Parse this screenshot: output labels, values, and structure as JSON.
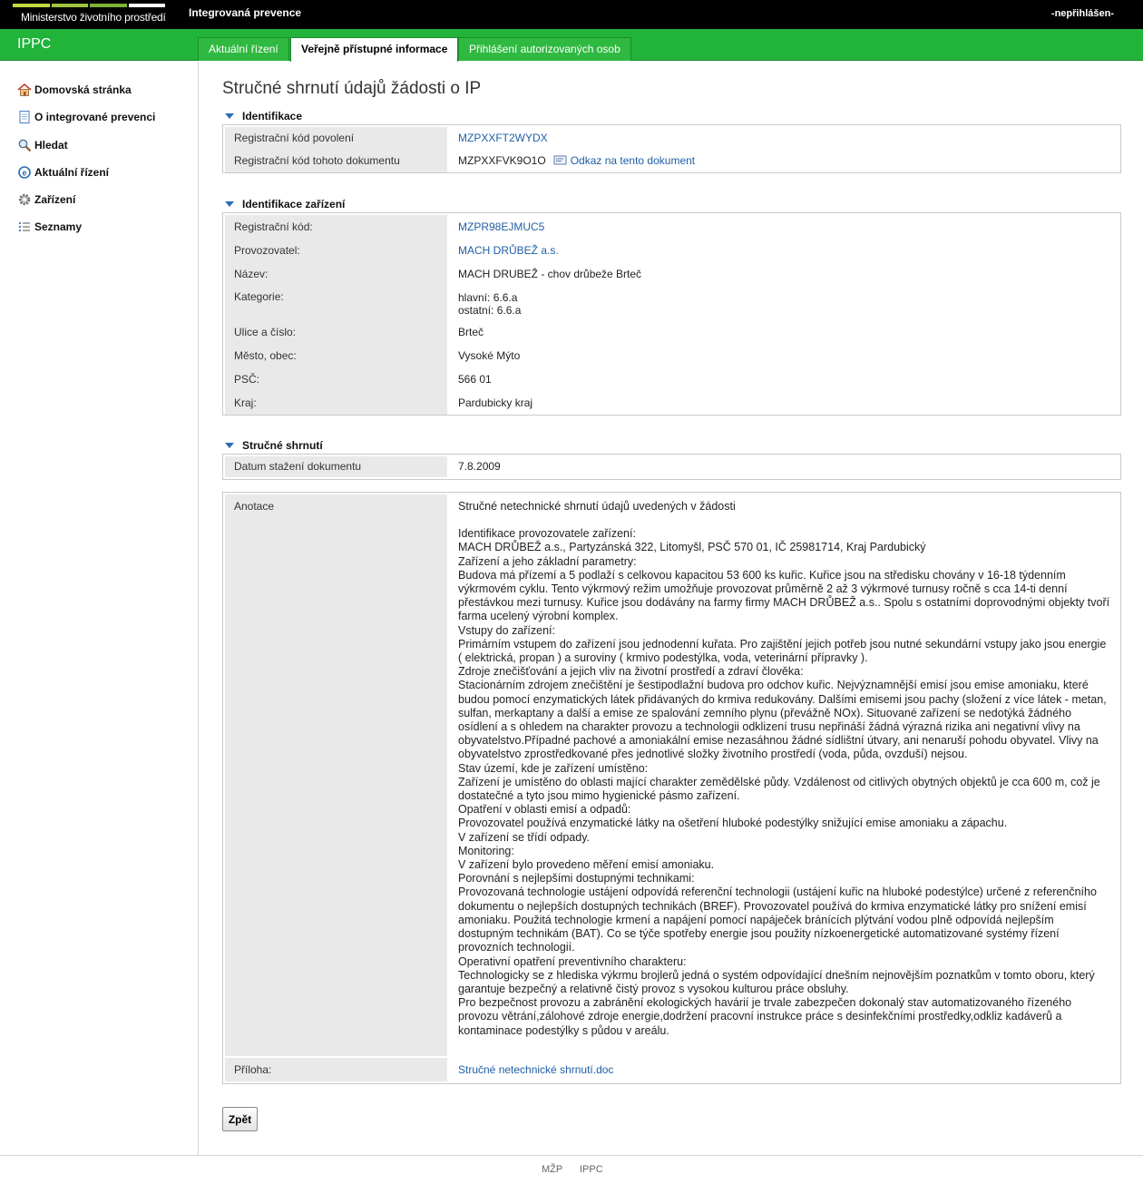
{
  "header": {
    "ministry_name": "Ministerstvo životního prostředí",
    "app_title": "Integrovaná prevence",
    "login_status": "-nepřihlášen-",
    "stripe_colors": [
      "#c3d93f",
      "#9fc43c",
      "#7fb239",
      "#ffffff"
    ]
  },
  "nav": {
    "app_code": "IPPC",
    "tabs": [
      {
        "label": "Aktuální řízení",
        "active": false
      },
      {
        "label": "Veřejně přístupné informace",
        "active": true
      },
      {
        "label": "Přihlášení autorizovaných osob",
        "active": false
      }
    ]
  },
  "sidebar": {
    "items": [
      {
        "label": "Domovská stránka",
        "icon": "home-icon"
      },
      {
        "label": "O integrované prevenci",
        "icon": "document-icon"
      },
      {
        "label": "Hledat",
        "icon": "magnifier-icon"
      },
      {
        "label": "Aktuální řízení",
        "icon": "e-icon"
      },
      {
        "label": "Zařízení",
        "icon": "gear-icon"
      },
      {
        "label": "Seznamy",
        "icon": "list-icon"
      }
    ]
  },
  "page": {
    "title": "Stručné shrnutí údajů žádosti o IP",
    "sections": {
      "identification": {
        "heading": "Identifikace",
        "rows": [
          {
            "label": "Registrační kód povolení",
            "value": "MZPXXFT2WYDX"
          },
          {
            "label": "Registrační kód tohoto dokumentu",
            "value": "MZPXXFVK9O1O",
            "link": "Odkaz na tento dokument"
          }
        ]
      },
      "facility": {
        "heading": "Identifikace zařízení",
        "rows": [
          {
            "label": "Registrační kód:",
            "value": "MZPR98EJMUC5"
          },
          {
            "label": "Provozovatel:",
            "value": "MACH DRŮBEŽ a.s."
          },
          {
            "label": "Název:",
            "value": "MACH DRUBEŽ - chov drůbeže Brteč"
          },
          {
            "label": "Kategorie:",
            "value": "hlavní: 6.6.a",
            "value2": "ostatní: 6.6.a"
          },
          {
            "label": "Ulice a číslo:",
            "value": "Brteč"
          },
          {
            "label": "Město, obec:",
            "value": "Vysoké Mýto"
          },
          {
            "label": "PSČ:",
            "value": "566 01"
          },
          {
            "label": "Kraj:",
            "value": "Pardubicky kraj"
          }
        ]
      },
      "summary": {
        "heading": "Stručné shrnutí",
        "download_label": "Datum stažení dokumentu",
        "download_date": "7.8.2009",
        "annotation_label": "Anotace",
        "annotation_title": "Stručné netechnické shrnutí údajů uvedených v žádosti",
        "annotation_lines": [
          "Identifikace provozovatele zařízení:",
          "MACH DRŮBEŽ a.s., Partyzánská 322, Litomyšl, PSČ 570 01, IČ 25981714, Kraj Pardubický",
          "Zařízení a jeho základní parametry:",
          "Budova má přízemí a 5 podlaží s celkovou kapacitou 53 600 ks kuřic. Kuřice jsou na středisku chovány v 16-18 týdenním výkrmovém cyklu. Tento výkrmový režim umožňuje provozovat průměrně 2 až 3 výkrmové turnusy ročně s cca 14-ti denní přestávkou mezi turnusy. Kuřice jsou dodávány na farmy firmy MACH DRŮBEŽ a.s.. Spolu s ostatními doprovodnými objekty tvoří farma ucelený výrobní komplex.",
          "Vstupy do zařízení:",
          "Primárním vstupem do zařízení jsou jednodenní kuřata. Pro zajištění jejich potřeb jsou nutné sekundární vstupy jako jsou energie ( elektrická, propan ) a suroviny ( krmivo podestýlka, voda, veterinární přípravky ).",
          "Zdroje znečišťování a jejich vliv na životní prostředí a zdraví člověka:",
          "Stacionárním zdrojem znečištění je šestipodlažní budova pro odchov kuřic. Nejvýznamnější emisí jsou emise amoniaku, které budou pomocí enzymatických látek přidávaných do krmiva redukovány. Dalšími emisemi jsou pachy (složení z více látek - metan, sulfan, merkaptany a další a emise ze spalování zemního plynu (převážně NOx). Situované zařízení se nedotýká žádného osídlení a s ohledem na charakter provozu a technologii odklizení trusu nepřináší žádná výrazná rizika ani negativní vlivy na obyvatelstvo.Případné pachové a amoniakální emise nezasáhnou žádné sídlištní útvary, ani nenaruší pohodu obyvatel. Vlivy na obyvatelstvo zprostředkované přes jednotlivé složky životního prostředí (voda, půda, ovzduší) nejsou.",
          "Stav území, kde je zařízení umístěno:",
          "Zařízení je umístěno do oblasti mající charakter zemědělské půdy. Vzdálenost od citlivých obytných objektů je cca 600 m, což je dostatečné a tyto jsou mimo hygienické pásmo zařízení.",
          "Opatření v oblasti emisí a odpadů:",
          "Provozovatel používá enzymatické látky na ošetření hluboké podestýlky snižující emise amoniaku a zápachu.",
          "V zařízení se třídí odpady.",
          "Monitoring:",
          "V zařízení bylo provedeno měření emisí amoniaku.",
          "Porovnání s nejlepšími dostupnými technikami:",
          "Provozovaná technologie ustájení odpovídá referenční technologii (ustájení kuřic na hluboké podestýlce) určené z referenčního dokumentu o nejlepších dostupných technikách (BREF). Provozovatel používá do krmiva enzymatické látky pro snížení emisí amoniaku. Použitá technologie krmení a napájení pomocí napáječek bránících plýtvání vodou plně odpovídá nejlepším dostupným technikám (BAT). Co se týče spotřeby energie jsou použity nízkoenergetické automatizované systémy řízení provozních technologií.",
          "Operativní opatření preventivního charakteru:",
          "Technologicky se z hlediska výkrmu brojlerů jedná o systém odpovídající dnešním nejnovějším poznatkům v tomto oboru, který garantuje bezpečný a relativně čistý provoz s vysokou kulturou práce obsluhy.",
          "Pro bezpečnost provozu a zabránění ekologických havárií je trvale zabezpečen dokonalý stav automatizovaného řízeného provozu větrání,zálohové zdroje energie,dodržení pracovní instrukce práce s desinfekčními prostředky,odkliz kadáverů a kontaminace podestýlky s půdou v areálu."
        ],
        "attachment_label": "Příloha:",
        "attachment_link": "Stručné netechnické shrnutí.doc"
      }
    },
    "back_button": "Zpět"
  },
  "footer": {
    "links": [
      "MŽP",
      "IPPC"
    ]
  },
  "colors": {
    "green_bar": "#22b33b",
    "link": "#1f5fa6",
    "label_bg": "#e9e9e9"
  }
}
